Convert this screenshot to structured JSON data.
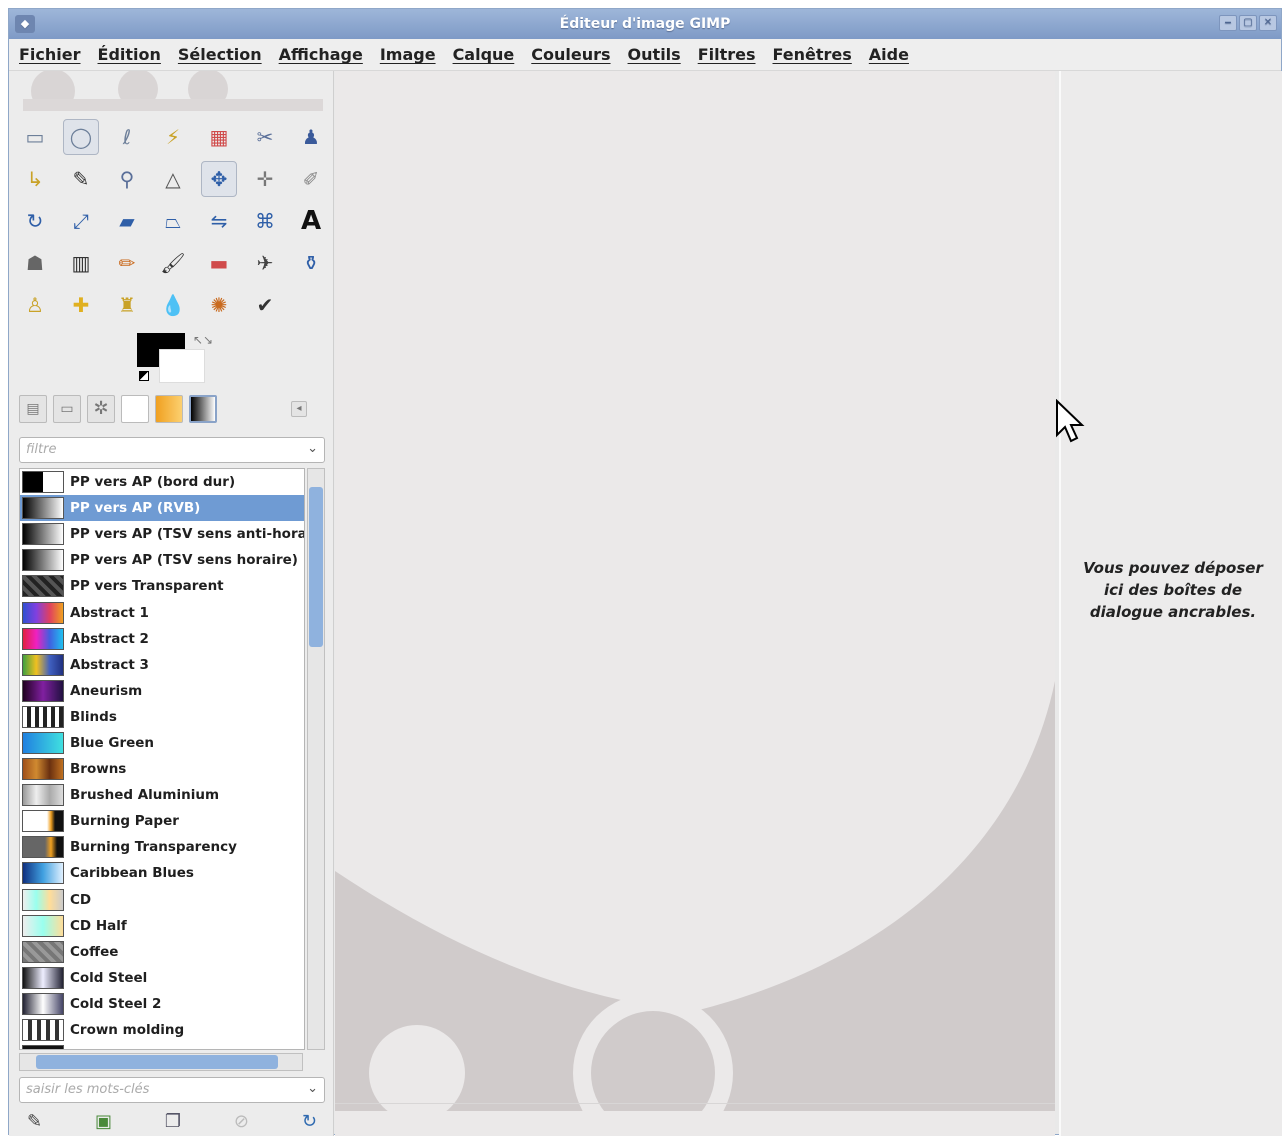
{
  "window": {
    "title": "Éditeur d'image GIMP",
    "controls": [
      "‒",
      "▢",
      "✕"
    ]
  },
  "menubar": [
    "Fichier",
    "Édition",
    "Sélection",
    "Affichage",
    "Image",
    "Calque",
    "Couleurs",
    "Outils",
    "Filtres",
    "Fenêtres",
    "Aide"
  ],
  "toolbox": {
    "tools": [
      {
        "name": "rect-select-icon",
        "glyph": "▭",
        "color": "#6d7f99"
      },
      {
        "name": "ellipse-select-icon",
        "glyph": "◯",
        "color": "#6d7f99",
        "selected": true
      },
      {
        "name": "free-select-icon",
        "glyph": "ℓ",
        "color": "#6d7f99"
      },
      {
        "name": "fuzzy-select-icon",
        "glyph": "⚡",
        "color": "#c9a227"
      },
      {
        "name": "color-select-icon",
        "glyph": "▦",
        "color": "#d04a4a"
      },
      {
        "name": "scissors-icon",
        "glyph": "✂",
        "color": "#5a6f99"
      },
      {
        "name": "foreground-select-icon",
        "glyph": "♟",
        "color": "#3a5a9a"
      },
      {
        "name": "paths-icon",
        "glyph": "↳",
        "color": "#c9a227"
      },
      {
        "name": "color-picker-icon",
        "glyph": "✎",
        "color": "#333"
      },
      {
        "name": "zoom-icon",
        "glyph": "⚲",
        "color": "#5a6f99"
      },
      {
        "name": "measure-icon",
        "glyph": "△",
        "color": "#555"
      },
      {
        "name": "move-icon",
        "glyph": "✥",
        "color": "#2f5fa8",
        "selected": true
      },
      {
        "name": "align-icon",
        "glyph": "✛",
        "color": "#777"
      },
      {
        "name": "crop-icon",
        "glyph": "✐",
        "color": "#888"
      },
      {
        "name": "rotate-icon",
        "glyph": "↻",
        "color": "#2f5fa8"
      },
      {
        "name": "scale-icon",
        "glyph": "⤢",
        "color": "#2f5fa8"
      },
      {
        "name": "shear-icon",
        "glyph": "▰",
        "color": "#2f5fa8"
      },
      {
        "name": "perspective-icon",
        "glyph": "⏢",
        "color": "#2f5fa8"
      },
      {
        "name": "flip-icon",
        "glyph": "⇋",
        "color": "#2f5fa8"
      },
      {
        "name": "cage-transform-icon",
        "glyph": "⌘",
        "color": "#2f5fa8"
      },
      {
        "name": "text-icon",
        "glyph": "A",
        "color": "#111"
      },
      {
        "name": "bucket-fill-icon",
        "glyph": "☗",
        "color": "#666"
      },
      {
        "name": "blend-icon",
        "glyph": "▥",
        "color": "#333"
      },
      {
        "name": "pencil-icon",
        "glyph": "✏",
        "color": "#c96a1e"
      },
      {
        "name": "paintbrush-icon",
        "glyph": "🖌",
        "color": "#333"
      },
      {
        "name": "eraser-icon",
        "glyph": "▬",
        "color": "#d04a4a"
      },
      {
        "name": "airbrush-icon",
        "glyph": "✈",
        "color": "#444"
      },
      {
        "name": "ink-icon",
        "glyph": "⚱",
        "color": "#2f5fa8"
      },
      {
        "name": "clone-icon",
        "glyph": "♙",
        "color": "#c9a227"
      },
      {
        "name": "heal-icon",
        "glyph": "✚",
        "color": "#e0b020"
      },
      {
        "name": "perspective-clone-icon",
        "glyph": "♜",
        "color": "#c9a227"
      },
      {
        "name": "smudge-icon",
        "glyph": "💧",
        "color": "#2f5fa8"
      },
      {
        "name": "blur-icon",
        "glyph": "✺",
        "color": "#c96a1e"
      },
      {
        "name": "dodge-burn-icon",
        "glyph": "✔",
        "color": "#333"
      }
    ]
  },
  "dock_tab_icons": [
    "tool-options-icon",
    "device-status-icon",
    "brushes-icon",
    "patterns-icon",
    "gradients-orange-icon",
    "gradients-icon"
  ],
  "filter_placeholder": "filtre",
  "gradients": [
    {
      "label": "PP vers AP (bord dur)",
      "swatch": "linear-gradient(90deg,#000 50%,#fff 50%)"
    },
    {
      "label": "PP vers AP (RVB)",
      "swatch": "linear-gradient(90deg,#000,#fff)",
      "selected": true
    },
    {
      "label": "PP vers AP (TSV sens anti-horaire)",
      "swatch": "linear-gradient(90deg,#000,#fff)"
    },
    {
      "label": "PP vers AP (TSV sens horaire)",
      "swatch": "linear-gradient(90deg,#000,#fff)"
    },
    {
      "label": "PP vers Transparent",
      "swatch": "repeating-linear-gradient(45deg,#222 0 4px,#555 4px 8px)"
    },
    {
      "label": "Abstract 1",
      "swatch": "linear-gradient(90deg,#3050d0,#8040e0,#e04060,#f0a020)"
    },
    {
      "label": "Abstract 2",
      "swatch": "linear-gradient(90deg,#e02040,#f020c0,#4060e0,#20c0f0)"
    },
    {
      "label": "Abstract 3",
      "swatch": "linear-gradient(90deg,#40a040,#f0c020,#4060c0,#203080)"
    },
    {
      "label": "Aneurism",
      "swatch": "linear-gradient(90deg,#200020,#8020a0,#201040)"
    },
    {
      "label": "Blinds",
      "swatch": "repeating-linear-gradient(90deg,#fff 0 4px,#222 4px 8px)"
    },
    {
      "label": "Blue Green",
      "swatch": "linear-gradient(90deg,#2080e0,#40e0e0)"
    },
    {
      "label": "Browns",
      "swatch": "linear-gradient(90deg,#a0501a,#d08a30,#6a3010,#c07020)"
    },
    {
      "label": "Brushed Aluminium",
      "swatch": "linear-gradient(90deg,#999,#eee,#aaa,#ddd)"
    },
    {
      "label": "Burning Paper",
      "swatch": "linear-gradient(90deg,#fff 60%,#f0a020 70%,#111 80%)"
    },
    {
      "label": "Burning Transparency",
      "swatch": "linear-gradient(90deg,#666 55%,#f0a020 70%,#111 85%)"
    },
    {
      "label": "Caribbean Blues",
      "swatch": "linear-gradient(90deg,#103080,#40a0e0,#e0f0ff)"
    },
    {
      "label": "CD",
      "swatch": "linear-gradient(90deg,#eee,#9fe,#fd9,#ccc)"
    },
    {
      "label": "CD Half",
      "swatch": "linear-gradient(90deg,#eee,#9fe,#fd9)"
    },
    {
      "label": "Coffee",
      "swatch": "repeating-linear-gradient(45deg,#777 0 4px,#999 4px 8px)"
    },
    {
      "label": "Cold Steel",
      "swatch": "linear-gradient(90deg,#111,#eef,#223)"
    },
    {
      "label": "Cold Steel 2",
      "swatch": "linear-gradient(90deg,#223,#fff,#446)"
    },
    {
      "label": "Crown molding",
      "swatch": "repeating-linear-gradient(90deg,#fff 0 5px,#333 5px 9px)"
    },
    {
      "label": "",
      "swatch": "linear-gradient(90deg,#111,#111)"
    }
  ],
  "tags_placeholder": "saisir les mots-clés",
  "gradient_actions": [
    "edit-gradient-icon",
    "new-gradient-icon",
    "duplicate-gradient-icon",
    "delete-gradient-icon",
    "refresh-gradients-icon"
  ],
  "dock_hint": "Vous pouvez déposer ici des boîtes de dialogue ancrables."
}
